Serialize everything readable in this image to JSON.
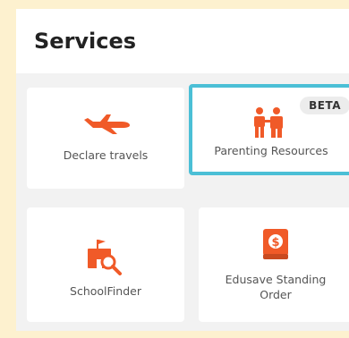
{
  "header": {
    "title": "Services"
  },
  "services": [
    {
      "label": "Declare travels",
      "icon": "airplane-icon",
      "color": "#f05a28"
    },
    {
      "label": "Parenting Resources",
      "icon": "family-icon",
      "color": "#f05a28",
      "badge": "BETA",
      "selected": true
    },
    {
      "label": "SchoolFinder",
      "icon": "school-search-icon",
      "color": "#f05a28"
    },
    {
      "label": "Edusave Standing Order",
      "icon": "dollar-book-icon",
      "color": "#f05a28"
    }
  ],
  "colors": {
    "accent": "#f05a28",
    "selection": "#4bbfd6",
    "background": "#fdf1cf"
  }
}
